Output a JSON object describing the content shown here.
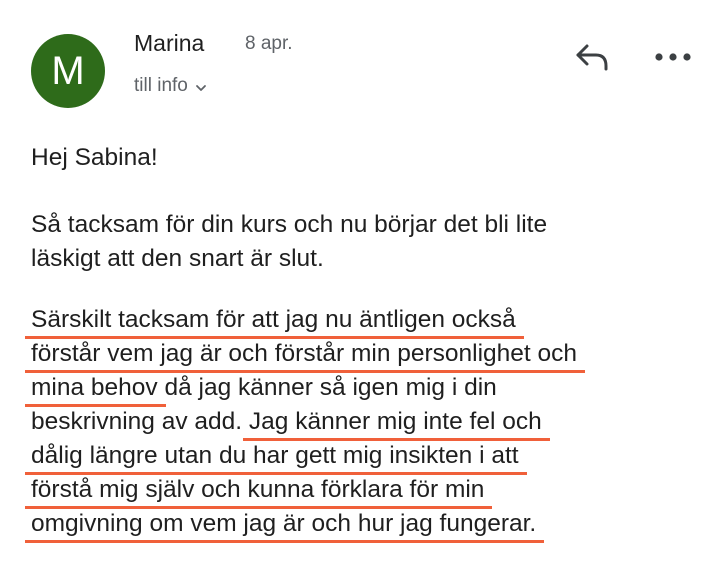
{
  "header": {
    "avatar_letter": "M",
    "avatar_color": "#2e6b1a",
    "sender": "Marina",
    "date": "8 apr.",
    "recipient": "till info",
    "icons": [
      "reply-icon",
      "more-icon",
      "chevron-down-icon"
    ]
  },
  "body": {
    "greeting": "Hej Sabina!",
    "para1": [
      "Så tacksam för din kurs och nu börjar det bli lite",
      "läskigt att den snart är slut."
    ],
    "para2": {
      "l1": "Särskilt tacksam för att jag nu äntligen också",
      "l2": "förstår vem jag är och förstår min personlighet och",
      "l3a": "mina behov",
      "l3b": " då jag känner så igen mig i din",
      "l4a": "beskrivning av add. ",
      "l4b": "Jag känner mig inte fel och",
      "l5": "dålig längre utan du har gett mig insikten i att",
      "l6": "förstå mig själv och kunna förklara för min",
      "l7": "omgivning om vem jag är och hur jag fungerar."
    },
    "highlight_color": "#f0603a"
  }
}
